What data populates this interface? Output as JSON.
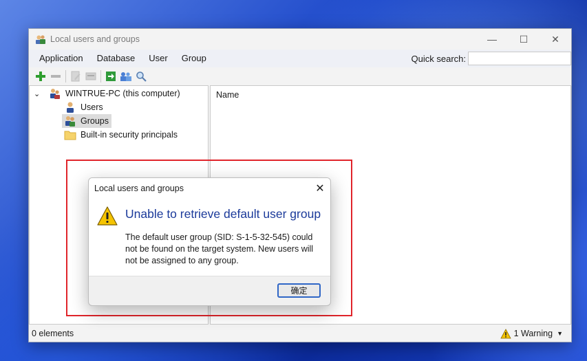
{
  "window": {
    "title": "Local users and groups",
    "controls": {
      "minimize": "—",
      "maximize": "☐",
      "close": "✕"
    }
  },
  "menubar": {
    "items": [
      {
        "label": "Application"
      },
      {
        "label": "Database"
      },
      {
        "label": "User"
      },
      {
        "label": "Group"
      }
    ],
    "quick_search_label": "Quick search:",
    "quick_search_value": ""
  },
  "toolbar": {
    "icons": [
      "add-icon",
      "remove-icon",
      "edit-icon",
      "properties-icon",
      "go-icon",
      "sync-icon",
      "search-icon"
    ]
  },
  "tree": {
    "root_label": "WINTRUE-PC (this computer)",
    "items": [
      {
        "label": "Users",
        "icon": "user-icon"
      },
      {
        "label": "Groups",
        "icon": "group-icon",
        "selected": true
      },
      {
        "label": "Built-in security principals",
        "icon": "folder-icon"
      }
    ]
  },
  "list": {
    "column_header": "Name"
  },
  "statusbar": {
    "element_count": "0 elements",
    "warnings": "1 Warning"
  },
  "dialog": {
    "title": "Local users and groups",
    "close": "✕",
    "heading": "Unable to retrieve default user group",
    "message": "The default user group (SID: S-1-5-32-545) could not be found on the target system. New users will not be assigned to any group.",
    "ok_label": "确定"
  },
  "colors": {
    "highlight_border": "#e0242a",
    "heading_text": "#1b3a9a",
    "warning_yellow": "#f5c400",
    "add_green": "#2e9e2e"
  }
}
